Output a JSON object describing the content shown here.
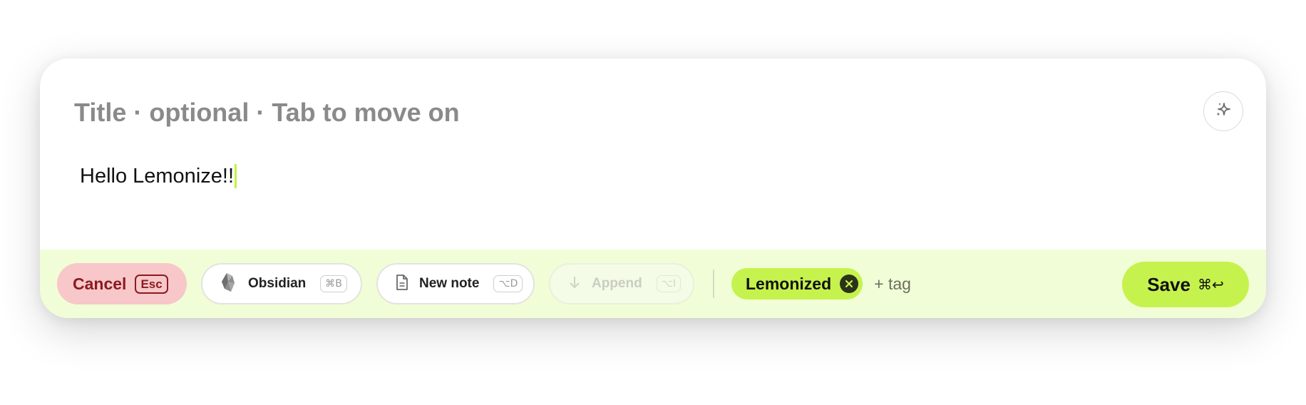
{
  "title_field": {
    "placeholder": "Title · optional · Tab to move on",
    "value": ""
  },
  "body": {
    "text": "Hello Lemonize!!"
  },
  "toolbar": {
    "cancel": {
      "label": "Cancel",
      "shortcut": "Esc"
    },
    "obsidian": {
      "label": "Obsidian",
      "shortcut": "⌘B",
      "icon": "obsidian-icon"
    },
    "new_note": {
      "label": "New note",
      "shortcut": "⌥D",
      "icon": "document-icon"
    },
    "append": {
      "label": "Append",
      "shortcut": "⌥I",
      "icon": "arrow-down-icon",
      "disabled": true
    },
    "tags": [
      {
        "label": "Lemonized"
      }
    ],
    "add_tag_label": "+ tag",
    "save": {
      "label": "Save",
      "shortcut": "⌘↩"
    }
  },
  "colors": {
    "accent": "#c6f24d",
    "toolbar_bg": "#f1fdd6",
    "cancel_bg": "#f7c7c9",
    "cancel_text": "#8b1a1f"
  }
}
